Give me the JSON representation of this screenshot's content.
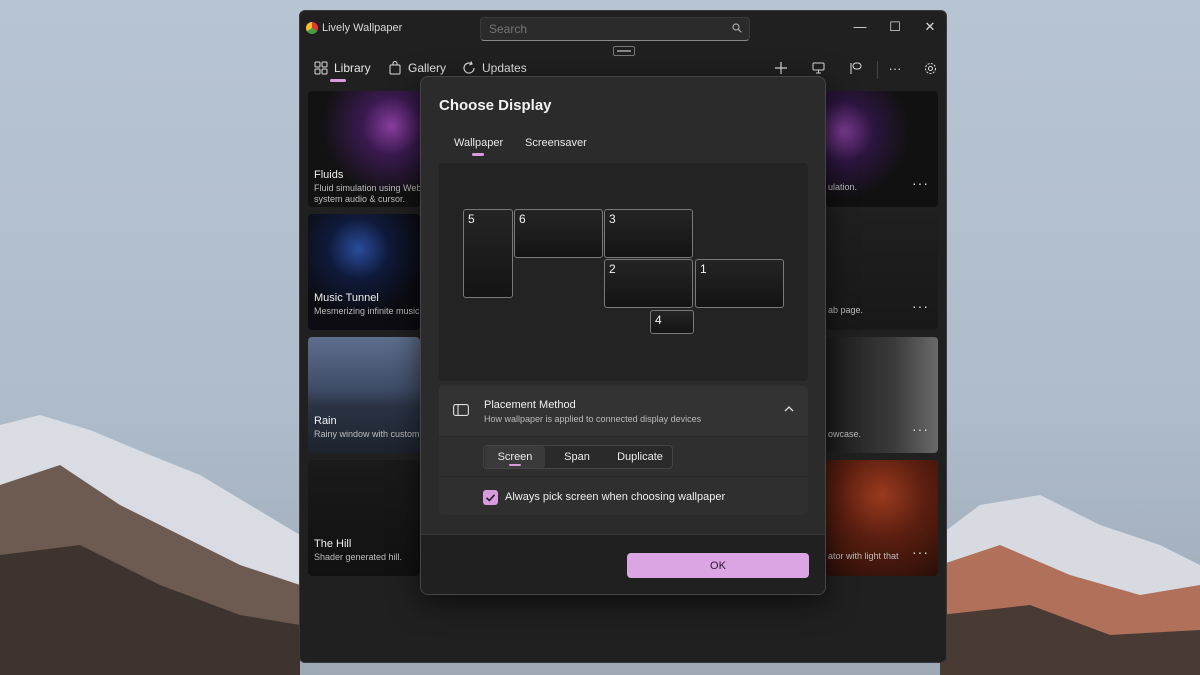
{
  "window": {
    "title": "Lively Wallpaper",
    "search_placeholder": "Search",
    "minimize": "—",
    "maximize": "☐",
    "close": "✕"
  },
  "nav": {
    "items": [
      {
        "label": "Library"
      },
      {
        "label": "Gallery"
      },
      {
        "label": "Updates"
      }
    ],
    "more": "···"
  },
  "library": {
    "cards_left": [
      {
        "title": "Fluids",
        "desc_line1": "Fluid simulation using Web",
        "desc_line2": "system audio & cursor."
      },
      {
        "title": "Music Tunnel",
        "desc_line1": "Mesmerizing infinite music",
        "desc_line2": ""
      },
      {
        "title": "Rain",
        "desc_line1": "Rainy window with custom",
        "desc_line2": ""
      },
      {
        "title": "The Hill",
        "desc_line1": "Shader generated hill.",
        "desc_line2": ""
      }
    ],
    "cards_right": [
      {
        "desc": "ulation.",
        "more": "···"
      },
      {
        "desc": "ab page.",
        "more": "···"
      },
      {
        "desc": "owcase.",
        "more": "···"
      },
      {
        "desc": "ator with light that",
        "more": "···"
      }
    ]
  },
  "dialog": {
    "title": "Choose Display",
    "tabs": [
      {
        "label": "Wallpaper",
        "selected": true
      },
      {
        "label": "Screensaver",
        "selected": false
      }
    ],
    "displays": [
      {
        "label": "5"
      },
      {
        "label": "6"
      },
      {
        "label": "3"
      },
      {
        "label": "2"
      },
      {
        "label": "1"
      },
      {
        "label": "4"
      }
    ],
    "placement": {
      "title": "Placement Method",
      "subtitle": "How wallpaper is applied to connected display devices",
      "options": [
        {
          "label": "Screen",
          "selected": true
        },
        {
          "label": "Span",
          "selected": false
        },
        {
          "label": "Duplicate",
          "selected": false
        }
      ],
      "checkbox_label": "Always pick screen when choosing wallpaper",
      "checkbox_checked": true
    },
    "ok_label": "OK"
  },
  "colors": {
    "accent": "#d89bdc",
    "dialog_bg": "#2b2b2b",
    "window_bg": "#202020"
  }
}
